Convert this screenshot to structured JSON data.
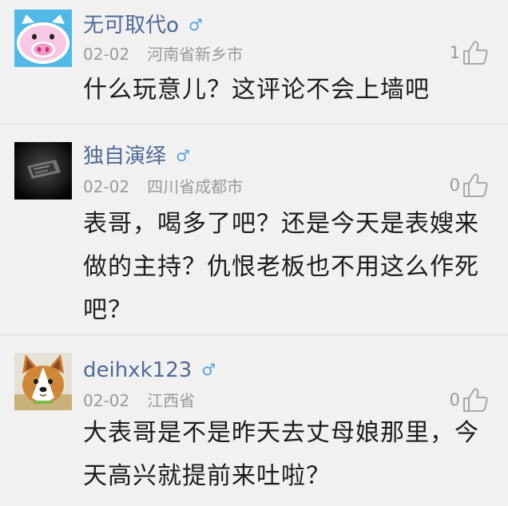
{
  "comments": [
    {
      "username": "无可取代o",
      "gender": "♂",
      "date": "02-02",
      "location": "河南省新乡市",
      "likes": "1",
      "text": "什么玩意儿？这评论不会上墙吧",
      "avatar_icon": "pink-pig-avatar"
    },
    {
      "username": "独自演绎",
      "gender": "♂",
      "date": "02-02",
      "location": "四川省成都市",
      "likes": "0",
      "text": "表哥，喝多了吧？还是今天是表嫂来做的主持？仇恨老板也不用这么作死吧？",
      "avatar_icon": "dark-photo-avatar"
    },
    {
      "username": "deihxk123",
      "gender": "♂",
      "date": "02-02",
      "location": "江西省",
      "likes": "0",
      "text": "大表哥是不是昨天去丈母娘那里，今天高兴就提前来吐啦？",
      "avatar_icon": "corgi-dog-avatar"
    }
  ],
  "colors": {
    "background": "#f1f1f1",
    "username": "#506a96",
    "meta": "#9a9a9a",
    "gender": "#54a3e0",
    "text": "#1c1c1c"
  }
}
